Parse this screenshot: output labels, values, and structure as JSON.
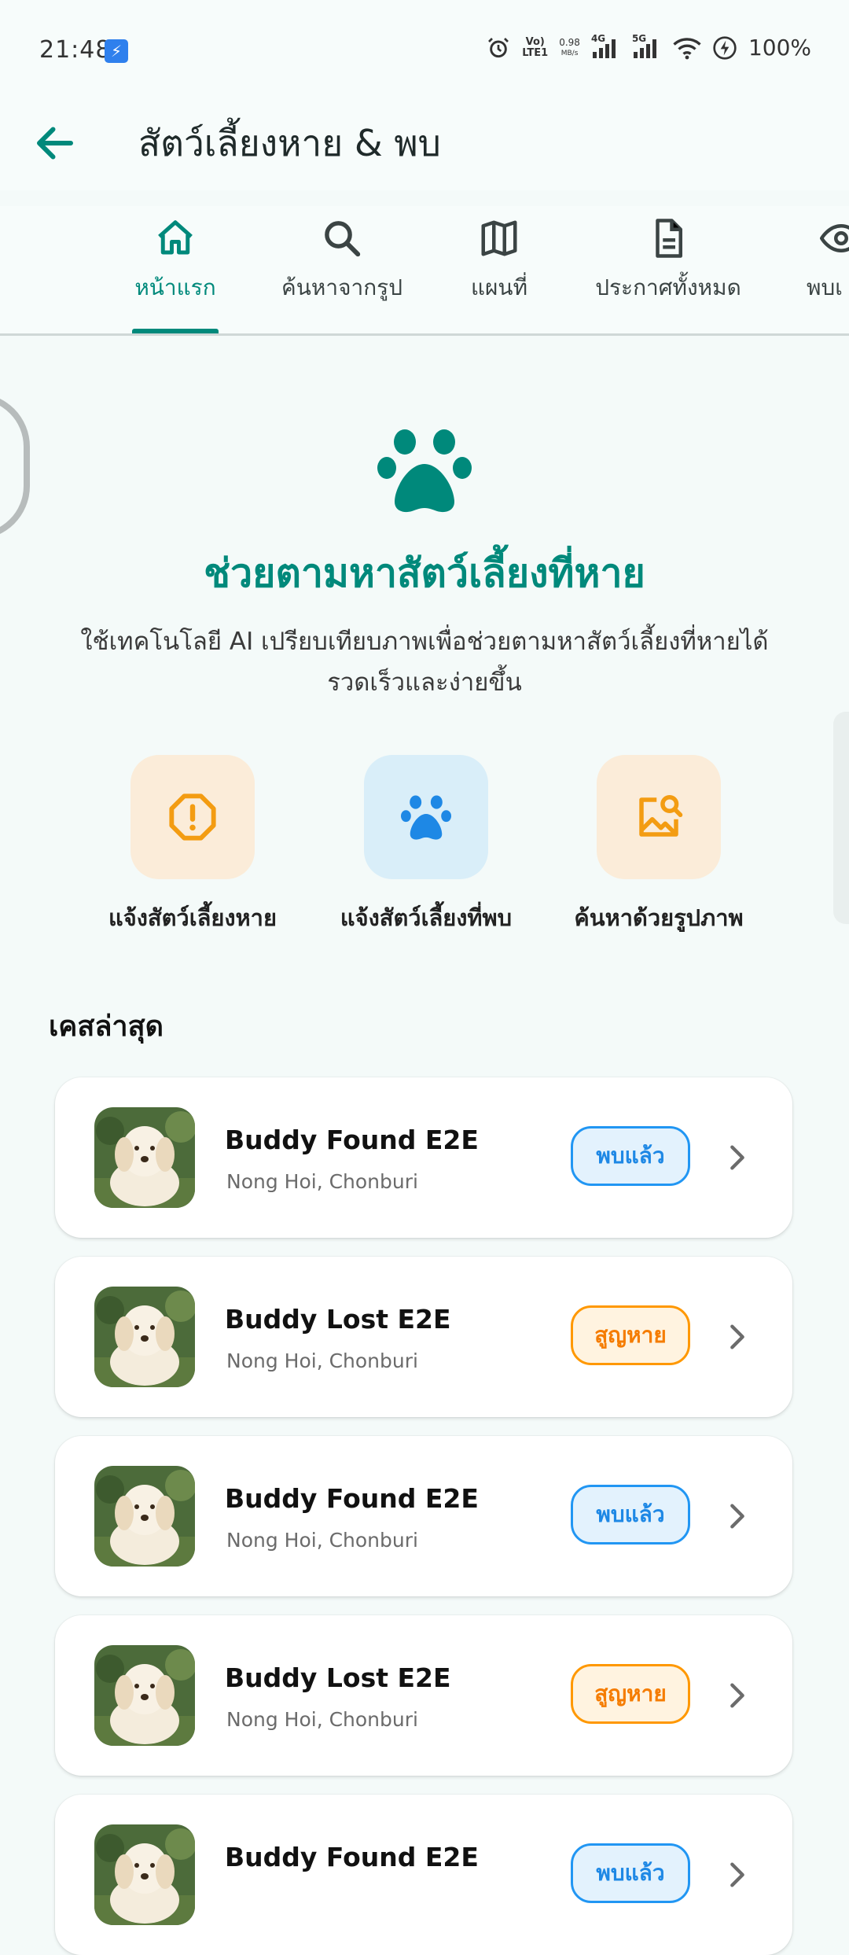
{
  "status_bar": {
    "time": "21:48",
    "network_speed": "0.98",
    "network_unit": "MB/s",
    "volte": "Vo)",
    "lte": "LTE1",
    "sig1": "4G",
    "sig2": "5G",
    "battery": "100%"
  },
  "app_bar": {
    "title": "สัตว์เลี้ยงหาย & พบ"
  },
  "tabs": [
    {
      "label": "หน้าแรก",
      "icon": "home-icon",
      "active": true
    },
    {
      "label": "ค้นหาจากรูป",
      "icon": "search-icon",
      "active": false
    },
    {
      "label": "แผนที่",
      "icon": "map-icon",
      "active": false
    },
    {
      "label": "ประกาศทั้งหมด",
      "icon": "document-icon",
      "active": false
    },
    {
      "label": "พบเ",
      "icon": "eye-icon",
      "active": false
    }
  ],
  "hero": {
    "title": "ช่วยตามหาสัตว์เลี้ยงที่หาย",
    "subtitle": "ใช้เทคโนโลยี AI เปรียบเทียบภาพเพื่อช่วยตามหาสัตว์เลี้ยงที่หายได้รวดเร็วและง่ายขึ้น"
  },
  "actions": [
    {
      "label": "แจ้งสัตว์เลี้ยงหาย",
      "icon": "alert-icon",
      "color": "#f39c12",
      "bg": "#fbecd9"
    },
    {
      "label": "แจ้งสัตว์เลี้ยงที่พบ",
      "icon": "paw-icon",
      "color": "#1e88e5",
      "bg": "#d9eef9"
    },
    {
      "label": "ค้นหาด้วยรูปภาพ",
      "icon": "image-search-icon",
      "color": "#f39c12",
      "bg": "#fbecd9"
    }
  ],
  "recent": {
    "title": "เคสล่าสุด",
    "cases": [
      {
        "title": "Buddy Found E2E",
        "location": "Nong Hoi, Chonburi",
        "status": "พบแล้ว",
        "type": "found"
      },
      {
        "title": "Buddy Lost E2E",
        "location": "Nong Hoi, Chonburi",
        "status": "สูญหาย",
        "type": "lost"
      },
      {
        "title": "Buddy Found E2E",
        "location": "Nong Hoi, Chonburi",
        "status": "พบแล้ว",
        "type": "found"
      },
      {
        "title": "Buddy Lost E2E",
        "location": "Nong Hoi, Chonburi",
        "status": "สูญหาย",
        "type": "lost"
      },
      {
        "title": "Buddy Found E2E",
        "location": "",
        "status": "พบแล้ว",
        "type": "found"
      }
    ]
  },
  "colors": {
    "accent": "#00897b",
    "found": "#1e88e5",
    "lost": "#f57c00"
  }
}
